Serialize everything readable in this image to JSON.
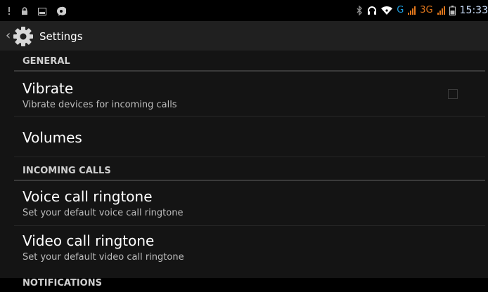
{
  "status_bar": {
    "network_g": "G",
    "network_3g": "3G",
    "time": "15:33",
    "accent_color": "#e0761b",
    "icons": [
      "usb-debug-icon",
      "lock-icon",
      "screenshot-icon",
      "app-notification-icon",
      "bluetooth-icon",
      "headset-icon",
      "wifi-icon",
      "signal-icon",
      "battery-icon"
    ]
  },
  "action_bar": {
    "title": "Settings"
  },
  "sections": {
    "general": "GENERAL",
    "incoming_calls": "INCOMING CALLS",
    "notifications": "NOTIFICATIONS"
  },
  "prefs": {
    "vibrate": {
      "title": "Vibrate",
      "summary": "Vibrate devices for incoming calls",
      "checked": false
    },
    "volumes": {
      "title": "Volumes"
    },
    "voice_ringtone": {
      "title": "Voice call ringtone",
      "summary": "Set your default voice call ringtone"
    },
    "video_ringtone": {
      "title": "Video call ringtone",
      "summary": "Set your default video call ringtone"
    }
  }
}
